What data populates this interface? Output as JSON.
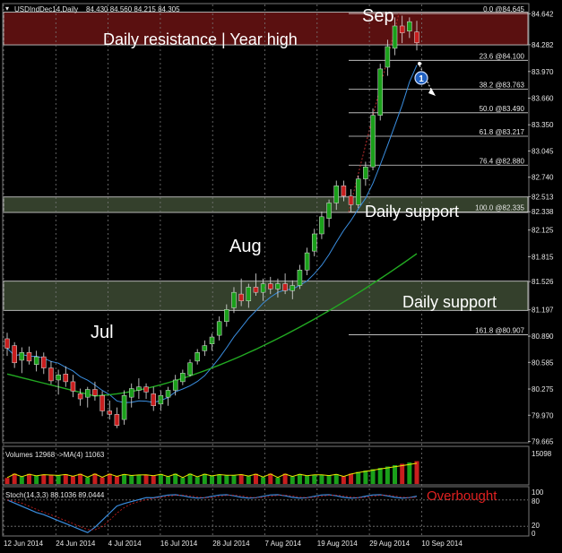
{
  "colors": {
    "background": "#000000",
    "bull": "#1aa01a",
    "bear": "#c81e1e",
    "ma_fast": "#3a8ee0",
    "ma_slow": "#22aa22",
    "resistance_zone": "#5a1010",
    "support_zone": "#34402c",
    "fib_line": "#d8d8d8",
    "volume_ma": "#e8e800",
    "stoch_main": "#3a8ee0",
    "stoch_signal": "#d02020",
    "text": "#e6e6e6"
  },
  "header": {
    "symbol_label": "USDIndDec14,Daily",
    "ohlc_label": "84.430 84.560 84.215 84.305"
  },
  "annotations": {
    "month_jul": "Jul",
    "month_aug": "Aug",
    "month_sep": "Sep",
    "resistance_label": "Daily resistance | Year high",
    "support_label_1": "Daily support",
    "support_label_2": "Daily support",
    "overbought_label": "Overbought",
    "marker_number": "1"
  },
  "volume_panel": {
    "label": "Volumes 12968 ->MA(4) 11063",
    "top_tick": "15098"
  },
  "stoch_panel": {
    "label": "Stoch(14,3,3) 88.1036 89.0444",
    "ticks": [
      "100",
      "80",
      "20",
      "0"
    ]
  },
  "chart_data": {
    "type": "candlestick",
    "title": "USDIndDec14,Daily",
    "ylim": [
      79.66,
      84.75
    ],
    "y_ticks": [
      "84.642",
      "84.282",
      "83.970",
      "83.660",
      "83.350",
      "83.045",
      "82.740",
      "82.513",
      "82.338",
      "82.125",
      "81.815",
      "81.526",
      "81.197",
      "80.890",
      "80.585",
      "80.275",
      "79.970",
      "79.665"
    ],
    "x_tick_labels": [
      "12 Jun 2014",
      "24 Jun 2014",
      "4 Jul 2014",
      "16 Jul 2014",
      "28 Jul 2014",
      "7 Aug 2014",
      "19 Aug 2014",
      "29 Aug 2014",
      "10 Sep 2014"
    ],
    "fibonacci_levels": [
      {
        "label": "0.0 @84.645",
        "value": 84.645
      },
      {
        "label": "23.6 @84.100",
        "value": 84.1
      },
      {
        "label": "38.2 @83.763",
        "value": 83.763
      },
      {
        "label": "50.0 @83.490",
        "value": 83.49
      },
      {
        "label": "61.8 @83.217",
        "value": 83.217
      },
      {
        "label": "76.4 @82.880",
        "value": 82.88
      },
      {
        "label": "100.0 @82.335",
        "value": 82.335
      },
      {
        "label": "161.8 @80.907",
        "value": 80.907
      }
    ],
    "zones": [
      {
        "name": "Daily resistance | Year high",
        "from": 84.28,
        "to": 84.66
      },
      {
        "name": "Daily support",
        "from": 82.33,
        "to": 82.51
      },
      {
        "name": "Daily support",
        "from": 81.19,
        "to": 81.53
      }
    ],
    "candles": [
      [
        80.86,
        80.93,
        80.66,
        80.75
      ],
      [
        80.78,
        80.82,
        80.52,
        80.58
      ],
      [
        80.61,
        80.76,
        80.46,
        80.7
      ],
      [
        80.7,
        80.77,
        80.56,
        80.6
      ],
      [
        80.56,
        80.72,
        80.48,
        80.65
      ],
      [
        80.65,
        80.7,
        80.45,
        80.52
      ],
      [
        80.52,
        80.6,
        80.33,
        80.37
      ],
      [
        80.38,
        80.5,
        80.21,
        80.44
      ],
      [
        80.45,
        80.54,
        80.3,
        80.36
      ],
      [
        80.36,
        80.44,
        80.18,
        80.25
      ],
      [
        80.22,
        80.28,
        80.08,
        80.16
      ],
      [
        80.18,
        80.3,
        80.06,
        80.27
      ],
      [
        80.27,
        80.36,
        80.14,
        80.2
      ],
      [
        80.2,
        80.25,
        79.96,
        80.02
      ],
      [
        80.02,
        80.14,
        79.92,
        79.98
      ],
      [
        79.98,
        80.06,
        79.82,
        79.85
      ],
      [
        79.92,
        80.26,
        79.86,
        80.2
      ],
      [
        80.18,
        80.34,
        80.06,
        80.28
      ],
      [
        80.26,
        80.4,
        80.16,
        80.3
      ],
      [
        80.3,
        80.34,
        80.16,
        80.24
      ],
      [
        80.22,
        80.3,
        80.02,
        80.08
      ],
      [
        80.1,
        80.26,
        80.02,
        80.2
      ],
      [
        80.18,
        80.3,
        80.08,
        80.26
      ],
      [
        80.26,
        80.44,
        80.2,
        80.38
      ],
      [
        80.36,
        80.5,
        80.32,
        80.46
      ],
      [
        80.44,
        80.62,
        80.42,
        80.58
      ],
      [
        80.6,
        80.74,
        80.56,
        80.7
      ],
      [
        80.72,
        80.84,
        80.66,
        80.78
      ],
      [
        80.8,
        80.92,
        80.72,
        80.88
      ],
      [
        80.9,
        81.12,
        80.84,
        81.06
      ],
      [
        81.06,
        81.26,
        81.0,
        81.2
      ],
      [
        81.22,
        81.46,
        81.16,
        81.4
      ],
      [
        81.38,
        81.56,
        81.24,
        81.3
      ],
      [
        81.3,
        81.5,
        81.22,
        81.46
      ],
      [
        81.46,
        81.62,
        81.36,
        81.4
      ],
      [
        81.4,
        81.56,
        81.3,
        81.5
      ],
      [
        81.5,
        81.58,
        81.38,
        81.44
      ],
      [
        81.44,
        81.56,
        81.34,
        81.5
      ],
      [
        81.5,
        81.62,
        81.38,
        81.42
      ],
      [
        81.42,
        81.54,
        81.32,
        81.48
      ],
      [
        81.48,
        81.72,
        81.44,
        81.66
      ],
      [
        81.66,
        81.92,
        81.6,
        81.86
      ],
      [
        81.88,
        82.14,
        81.82,
        82.08
      ],
      [
        82.08,
        82.34,
        82.02,
        82.28
      ],
      [
        82.26,
        82.48,
        82.16,
        82.44
      ],
      [
        82.44,
        82.7,
        82.36,
        82.64
      ],
      [
        82.64,
        82.7,
        82.46,
        82.52
      ],
      [
        82.52,
        82.6,
        82.34,
        82.42
      ],
      [
        82.42,
        82.76,
        82.38,
        82.72
      ],
      [
        82.72,
        82.92,
        82.64,
        82.86
      ],
      [
        82.86,
        83.54,
        82.82,
        83.46
      ],
      [
        83.46,
        84.06,
        83.4,
        84.0
      ],
      [
        84.02,
        84.34,
        83.92,
        84.26
      ],
      [
        84.24,
        84.6,
        84.16,
        84.5
      ],
      [
        84.5,
        84.62,
        84.3,
        84.42
      ],
      [
        84.44,
        84.6,
        84.36,
        84.55
      ],
      [
        84.43,
        84.56,
        84.215,
        84.305
      ]
    ],
    "indicators": {
      "fast_ma_end": 83.88,
      "slow_ma_end": 81.85
    }
  }
}
